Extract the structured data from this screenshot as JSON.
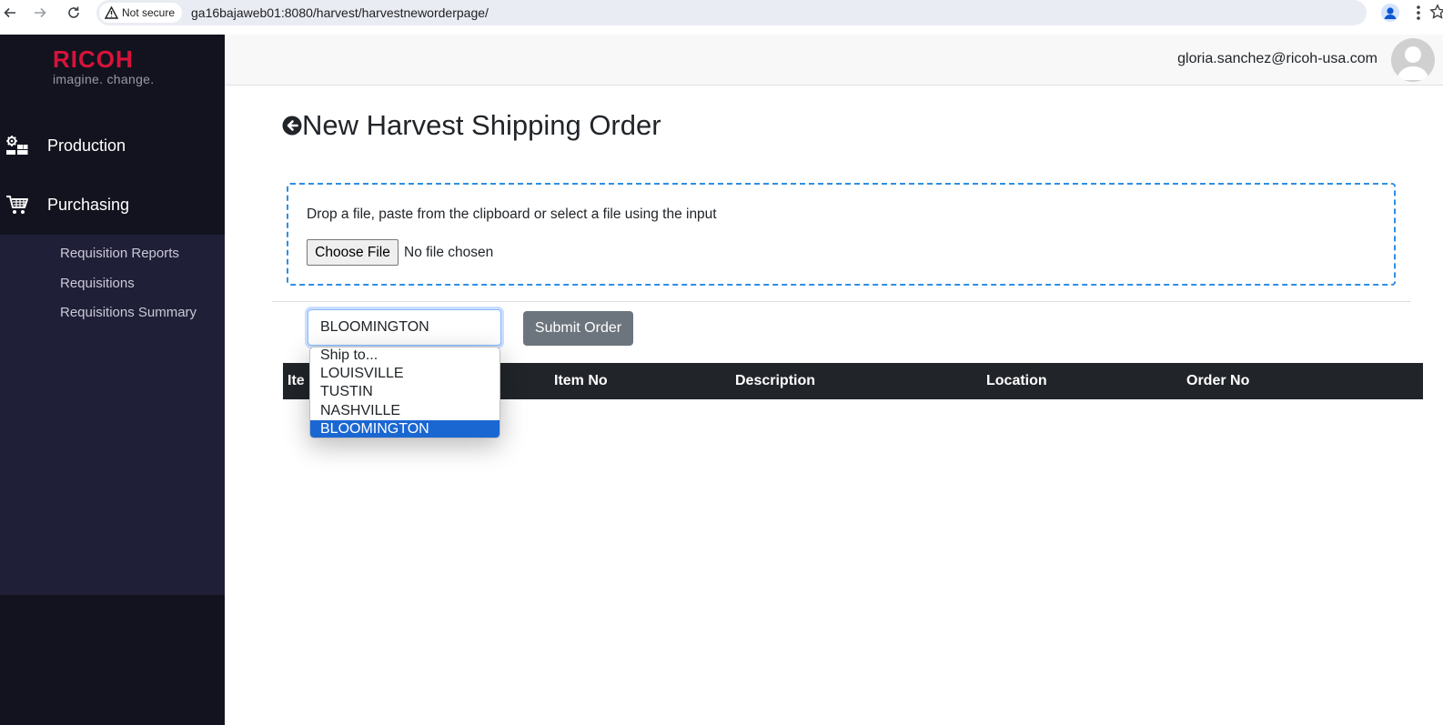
{
  "browser": {
    "back_icon": "arrow-left-icon",
    "forward_icon": "arrow-right-icon",
    "reload_icon": "reload-icon",
    "security_label": "Not secure",
    "url": "ga16bajaweb01:8080/harvest/harvestneworderpage/",
    "bookmark_icon": "star-icon",
    "profile_icon": "person-icon",
    "menu_icon": "kebab-icon"
  },
  "sidebar": {
    "logo": {
      "word": "RICOH",
      "tagline": "imagine. change."
    },
    "items": [
      {
        "label": "Production",
        "icon": "production-icon"
      },
      {
        "label": "Purchasing",
        "icon": "cart-icon"
      }
    ],
    "submenu": [
      {
        "label": "Requisition Reports"
      },
      {
        "label": "Requisitions"
      },
      {
        "label": "Requisitions Summary"
      }
    ]
  },
  "header": {
    "user_email": "gloria.sanchez@ricoh-usa.com"
  },
  "main": {
    "title": "New Harvest Shipping Order",
    "dropzone": {
      "hint": "Drop a file, paste from the clipboard or select a file using the input",
      "file_button": "Choose File",
      "file_status": "No file chosen"
    },
    "ship_to": {
      "selected": "BLOOMINGTON",
      "options": [
        "Ship to...",
        "LOUISVILLE",
        "TUSTIN",
        "NASHVILLE",
        "BLOOMINGTON"
      ]
    },
    "submit_label": "Submit Order",
    "table": {
      "columns": [
        "Item",
        "Item No",
        "Description",
        "Location",
        "Order No"
      ],
      "visible_first_column": "Ite"
    }
  },
  "colors": {
    "sidebar_bg": "#13131f",
    "submenu_bg": "#201f38",
    "brand_red": "#d7133b",
    "dropzone_border": "#2f8ee5",
    "table_header": "#212529",
    "submit_button": "#6c757d",
    "option_highlight": "#1a67d2"
  }
}
